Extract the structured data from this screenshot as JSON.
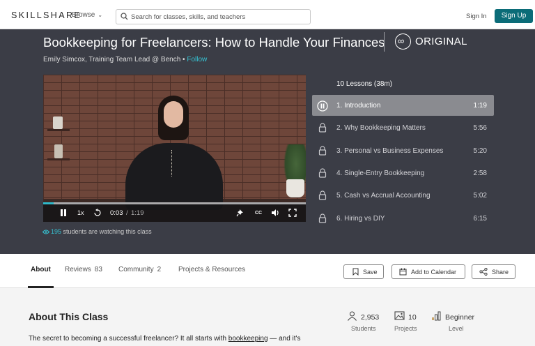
{
  "header": {
    "logo": "SKILLSHARE",
    "browse_label": "Browse",
    "search_placeholder": "Search for classes, skills, and teachers",
    "signin_label": "Sign In",
    "signup_label": "Sign Up"
  },
  "course": {
    "title": "Bookkeeping for Freelancers: How to Handle Your Finances",
    "badge": "ORIGINAL",
    "teacher": "Emily Simcox, Training Team Lead @ Bench",
    "separator": " • ",
    "follow_label": "Follow"
  },
  "player": {
    "speed": "1x",
    "current_time": "0:03",
    "time_separator": "/",
    "duration": "1:19",
    "progress_fraction": 0.04,
    "watching_count": "195",
    "watching_text": " students are watching this class"
  },
  "lessons": {
    "heading": "10 Lessons (38m)",
    "items": [
      {
        "label": "1. Introduction",
        "duration": "1:19",
        "active": true
      },
      {
        "label": "2. Why Bookkeeping Matters",
        "duration": "5:56"
      },
      {
        "label": "3. Personal vs Business Expenses",
        "duration": "5:20"
      },
      {
        "label": "4. Single-Entry Bookkeeping",
        "duration": "2:58"
      },
      {
        "label": "5. Cash vs Accrual Accounting",
        "duration": "5:02"
      },
      {
        "label": "6. Hiring vs DIY",
        "duration": "6:15"
      }
    ]
  },
  "tabs": {
    "about": "About",
    "reviews": "Reviews",
    "reviews_count": "83",
    "community": "Community",
    "community_count": "2",
    "projects": "Projects & Resources"
  },
  "actions": {
    "save": "Save",
    "calendar": "Add to Calendar",
    "share": "Share"
  },
  "about": {
    "title": "About This Class",
    "text_before": "The secret to becoming a successful freelancer? It all starts with ",
    "text_keyword": "bookkeeping",
    "text_after": " — and it's"
  },
  "stats": {
    "students_value": "2,953",
    "students_label": "Students",
    "projects_value": "10",
    "projects_label": "Projects",
    "level_value": "Beginner",
    "level_label": "Level"
  },
  "colors": {
    "accent": "#0b6c78",
    "link": "#36c4d4",
    "hero_bg": "#3b3d46",
    "active_lesson": "#8a8b90"
  }
}
